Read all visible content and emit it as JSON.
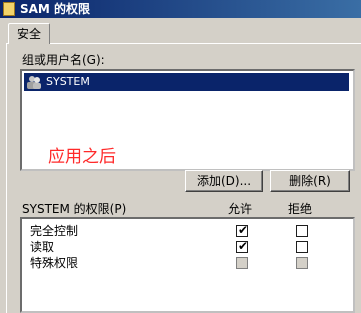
{
  "window": {
    "title": "SAM 的权限"
  },
  "tab": {
    "label": "安全"
  },
  "groups": {
    "label": "组或用户名(G):",
    "items": [
      {
        "name": "SYSTEM",
        "selected": true
      }
    ]
  },
  "annotation": {
    "text": "应用之后"
  },
  "buttons": {
    "add": "添加(D)...",
    "remove": "删除(R)"
  },
  "permissions": {
    "title": "SYSTEM 的权限(P)",
    "allow_header": "允许",
    "deny_header": "拒绝",
    "rows": [
      {
        "name": "完全控制",
        "allow": true,
        "deny": false,
        "enabled": true
      },
      {
        "name": "读取",
        "allow": true,
        "deny": false,
        "enabled": true
      },
      {
        "name": "特殊权限",
        "allow": false,
        "deny": false,
        "enabled": false
      }
    ]
  },
  "colors": {
    "titlebar": "#0a246a",
    "selection": "#0a246a",
    "annotation": "#ff2a2a",
    "dialog": "#d4d0c8"
  }
}
